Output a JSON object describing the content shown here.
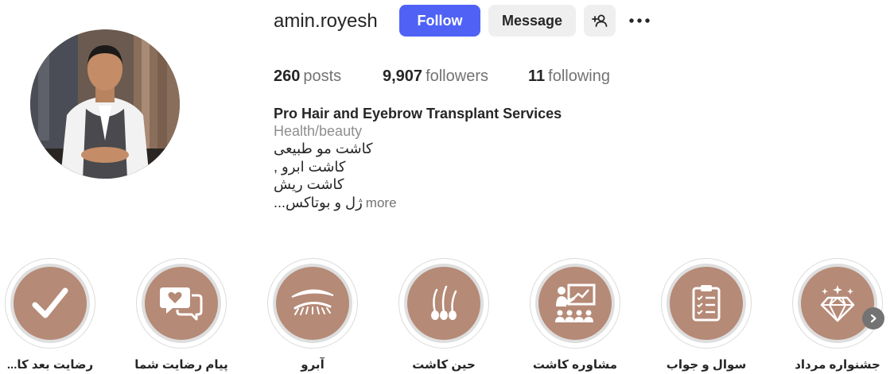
{
  "profile": {
    "username": "amin.royesh",
    "follow_label": "Follow",
    "message_label": "Message"
  },
  "stats": {
    "posts_count": "260",
    "posts_label": "posts",
    "followers_count": "9,907",
    "followers_label": "followers",
    "following_count": "11",
    "following_label": "following"
  },
  "bio": {
    "name": "Pro Hair and Eyebrow Transplant Services",
    "category": "Health/beauty",
    "lines": [
      "کاشت مو طبیعی",
      "کاشت ابرو ,",
      "کاشت ریش",
      "ژل و بوتاکس..."
    ],
    "more_label": "more"
  },
  "highlights": [
    {
      "label": "رضایت بعد کا...",
      "icon": "checkmark-icon"
    },
    {
      "label": "پیام رضایت شما",
      "icon": "chat-heart-icon"
    },
    {
      "label": "آبرو",
      "icon": "eyebrow-icon"
    },
    {
      "label": "حین کاشت",
      "icon": "hair-follicle-icon"
    },
    {
      "label": "مشاوره کاشت",
      "icon": "presentation-icon"
    },
    {
      "label": "سوال و جواب",
      "icon": "clipboard-checklist-icon"
    },
    {
      "label": "جشنواره مرداد",
      "icon": "diamond-icon"
    }
  ],
  "colors": {
    "follow_button": "#4f62f5",
    "highlight_fill": "#b58a77",
    "muted_text": "#737373"
  }
}
